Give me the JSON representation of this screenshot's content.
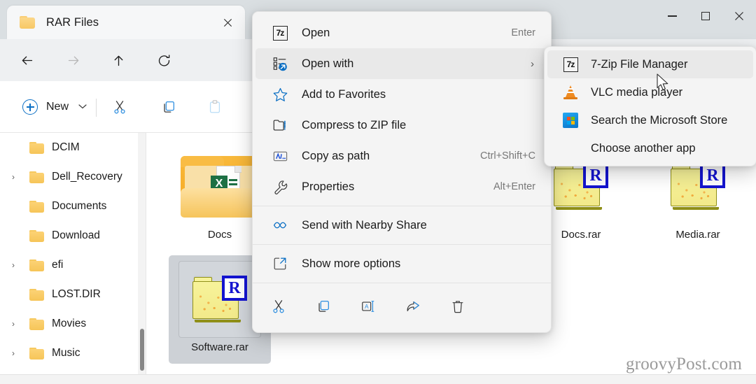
{
  "window": {
    "tab_title": "RAR Files",
    "tab_folder_icon": "folder-icon",
    "close_tab_icon": "close-icon",
    "minimize_label": "minimize-icon",
    "maximize_label": "maximize-icon",
    "close_label": "close-icon"
  },
  "nav": {
    "back_icon": "back-arrow-icon",
    "forward_icon": "forward-arrow-icon",
    "up_icon": "up-arrow-icon",
    "refresh_icon": "refresh-icon",
    "address_pc_icon": "this-pc-icon",
    "address_chevron": "›"
  },
  "commandbar": {
    "new_label": "New",
    "new_caret": "⌄",
    "cut_icon": "cut-icon",
    "copy_icon": "copy-icon",
    "paste_icon": "paste-icon"
  },
  "sidebar": {
    "items": [
      {
        "label": "DCIM",
        "expandable": false
      },
      {
        "label": "Dell_Recovery",
        "expandable": true
      },
      {
        "label": "Documents",
        "expandable": false
      },
      {
        "label": "Download",
        "expandable": false
      },
      {
        "label": "efi",
        "expandable": true
      },
      {
        "label": "LOST.DIR",
        "expandable": false
      },
      {
        "label": "Movies",
        "expandable": true
      },
      {
        "label": "Music",
        "expandable": true
      }
    ],
    "chevron": "›"
  },
  "files": [
    {
      "name": "Docs",
      "type": "folder-excel",
      "selected": false
    },
    {
      "name": "Software.rar",
      "type": "rar",
      "selected": true
    },
    {
      "name": "Docs.rar",
      "type": "rar",
      "selected": false
    },
    {
      "name": "Media.rar",
      "type": "rar",
      "selected": false
    }
  ],
  "context_menu": {
    "items": [
      {
        "label": "Open",
        "accel": "Enter",
        "icon": "seven-zip-icon",
        "highlighted": false,
        "submenu": false
      },
      {
        "label": "Open with",
        "accel": "",
        "icon": "open-with-icon",
        "highlighted": true,
        "submenu": true
      },
      {
        "label": "Add to Favorites",
        "accel": "",
        "icon": "star-icon",
        "highlighted": false,
        "submenu": false
      },
      {
        "label": "Compress to ZIP file",
        "accel": "",
        "icon": "zip-folder-icon",
        "highlighted": false,
        "submenu": false
      },
      {
        "label": "Copy as path",
        "accel": "Ctrl+Shift+C",
        "icon": "copy-path-icon",
        "highlighted": false,
        "submenu": false
      },
      {
        "label": "Properties",
        "accel": "Alt+Enter",
        "icon": "wrench-icon",
        "highlighted": false,
        "submenu": false
      },
      {
        "label": "Send with Nearby Share",
        "accel": "",
        "icon": "nearby-share-icon",
        "highlighted": false,
        "submenu": false
      },
      {
        "label": "Show more options",
        "accel": "",
        "icon": "show-more-options-icon",
        "highlighted": false,
        "submenu": false
      }
    ],
    "submenu_chevron": "›",
    "action_icons": [
      "cut-icon",
      "copy-icon",
      "rename-icon",
      "share-icon",
      "delete-icon"
    ]
  },
  "open_with_submenu": {
    "items": [
      {
        "label": "7-Zip File Manager",
        "icon": "seven-zip-icon",
        "highlighted": true
      },
      {
        "label": "VLC media player",
        "icon": "vlc-icon",
        "highlighted": false
      },
      {
        "label": "Search the Microsoft Store",
        "icon": "microsoft-store-icon",
        "highlighted": false
      },
      {
        "label": "Choose another app",
        "icon": "",
        "highlighted": false
      }
    ]
  },
  "watermark": {
    "text": "groovyPost.com"
  },
  "colors": {
    "accent": "#0b6fc4",
    "titlebar": "#dadfe2",
    "menu_bg": "#f4f4f4",
    "selection": "#cdd1d6"
  }
}
